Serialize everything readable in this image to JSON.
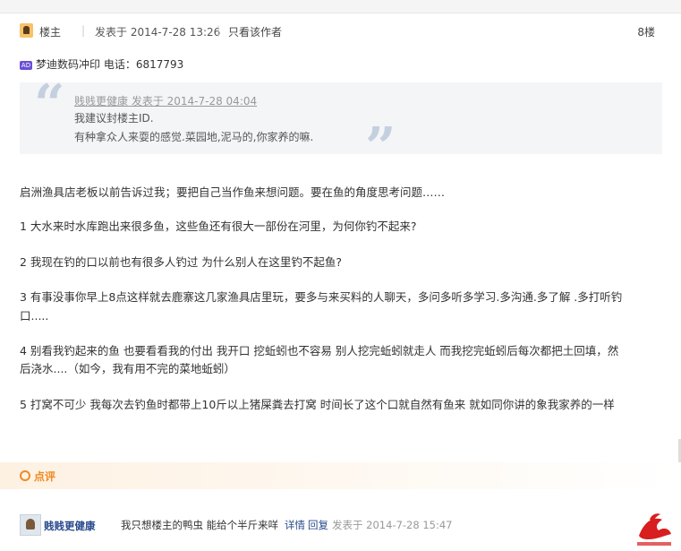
{
  "post": {
    "header": {
      "role": "楼主",
      "posted_at": "发表于 2014-7-28 13:26",
      "only_author": "只看该作者",
      "floor": "8楼"
    },
    "ad": {
      "badge": "AD",
      "text": "梦迪数码冲印 电话：6817793"
    },
    "quote": {
      "header": "贱贱更健康 发表于 2014-7-28 04:04",
      "lines": [
        "我建议封楼主ID.",
        "有种拿众人来耍的感觉.菜园地,泥马的,你家养的嘛."
      ]
    },
    "paragraphs": [
      "启洲渔具店老板以前告诉过我；要把自己当作鱼来想问题。要在鱼的角度思考问题……",
      "1 大水来时水库跑出来很多鱼，这些鱼还有很大一部份在河里，为何你钓不起来?",
      "2 我现在钓的口以前也有很多人钓过 为什么别人在这里钓不起鱼?",
      "3 有事没事你早上8点这样就去鹿寨这几家渔具店里玩，要多与来买料的人聊天，多问多听多学习.多沟通.多了解 .多打听钓",
      "口.....",
      "4 别看我钓起来的鱼 也要看看我的付出 我开口 挖蚯蚓也不容易 别人挖完蚯蚓就走人 而我挖完蚯蚓后每次都把土回填，然",
      "后浇水....（如今，我有用不完的菜地蚯蚓）",
      "5 打窝不可少 我每次去钓鱼时都带上10斤以上猪屎粪去打窝 时间长了这个口就自然有鱼来 就如同你讲的象我家养的一样"
    ]
  },
  "reviews": {
    "label": "点评",
    "items": [
      {
        "user": "贱贱更健康",
        "text": "我只想楼主的鸭虫 能给个半斤来咩",
        "detail": "详情",
        "reply": "回复",
        "time": "发表于 2014-7-28 15:47"
      }
    ]
  },
  "colors": {
    "accent_orange": "#f08a24",
    "link_blue": "#2a4b8c",
    "quote_bg": "#f4f5f7"
  },
  "icons": [
    "author-icon",
    "ad-badge-icon",
    "quote-open-icon",
    "quote-close-icon",
    "review-circle-icon",
    "avatar",
    "watermark-logo"
  ]
}
